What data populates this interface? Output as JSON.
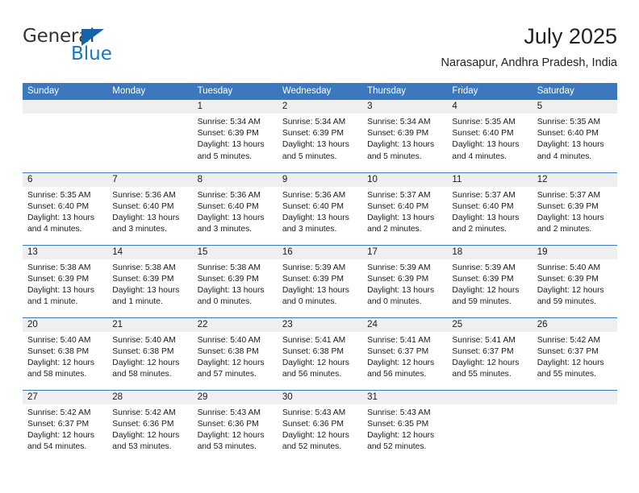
{
  "branding": {
    "logo_primary": "General",
    "logo_secondary": "Blue",
    "logo_triangle_icon": "triangle-icon",
    "primary_color": "#1464AA",
    "secondary_color": "#1778C2"
  },
  "header": {
    "title": "July 2025",
    "subtitle": "Narasapur, Andhra Pradesh, India"
  },
  "theme": {
    "header_bg": "#3C78BE",
    "daynum_bg": "#EFEFEF",
    "text_color": "#1a1a1a"
  },
  "columns": [
    "Sunday",
    "Monday",
    "Tuesday",
    "Wednesday",
    "Thursday",
    "Friday",
    "Saturday"
  ],
  "weeks": [
    [
      {
        "day": "",
        "blank": true
      },
      {
        "day": "",
        "blank": true
      },
      {
        "day": "1",
        "sunrise": "Sunrise: 5:34 AM",
        "sunset": "Sunset: 6:39 PM",
        "daylight1": "Daylight: 13 hours",
        "daylight2": "and 5 minutes."
      },
      {
        "day": "2",
        "sunrise": "Sunrise: 5:34 AM",
        "sunset": "Sunset: 6:39 PM",
        "daylight1": "Daylight: 13 hours",
        "daylight2": "and 5 minutes."
      },
      {
        "day": "3",
        "sunrise": "Sunrise: 5:34 AM",
        "sunset": "Sunset: 6:39 PM",
        "daylight1": "Daylight: 13 hours",
        "daylight2": "and 5 minutes."
      },
      {
        "day": "4",
        "sunrise": "Sunrise: 5:35 AM",
        "sunset": "Sunset: 6:40 PM",
        "daylight1": "Daylight: 13 hours",
        "daylight2": "and 4 minutes."
      },
      {
        "day": "5",
        "sunrise": "Sunrise: 5:35 AM",
        "sunset": "Sunset: 6:40 PM",
        "daylight1": "Daylight: 13 hours",
        "daylight2": "and 4 minutes."
      }
    ],
    [
      {
        "day": "6",
        "sunrise": "Sunrise: 5:35 AM",
        "sunset": "Sunset: 6:40 PM",
        "daylight1": "Daylight: 13 hours",
        "daylight2": "and 4 minutes."
      },
      {
        "day": "7",
        "sunrise": "Sunrise: 5:36 AM",
        "sunset": "Sunset: 6:40 PM",
        "daylight1": "Daylight: 13 hours",
        "daylight2": "and 3 minutes."
      },
      {
        "day": "8",
        "sunrise": "Sunrise: 5:36 AM",
        "sunset": "Sunset: 6:40 PM",
        "daylight1": "Daylight: 13 hours",
        "daylight2": "and 3 minutes."
      },
      {
        "day": "9",
        "sunrise": "Sunrise: 5:36 AM",
        "sunset": "Sunset: 6:40 PM",
        "daylight1": "Daylight: 13 hours",
        "daylight2": "and 3 minutes."
      },
      {
        "day": "10",
        "sunrise": "Sunrise: 5:37 AM",
        "sunset": "Sunset: 6:40 PM",
        "daylight1": "Daylight: 13 hours",
        "daylight2": "and 2 minutes."
      },
      {
        "day": "11",
        "sunrise": "Sunrise: 5:37 AM",
        "sunset": "Sunset: 6:40 PM",
        "daylight1": "Daylight: 13 hours",
        "daylight2": "and 2 minutes."
      },
      {
        "day": "12",
        "sunrise": "Sunrise: 5:37 AM",
        "sunset": "Sunset: 6:39 PM",
        "daylight1": "Daylight: 13 hours",
        "daylight2": "and 2 minutes."
      }
    ],
    [
      {
        "day": "13",
        "sunrise": "Sunrise: 5:38 AM",
        "sunset": "Sunset: 6:39 PM",
        "daylight1": "Daylight: 13 hours",
        "daylight2": "and 1 minute."
      },
      {
        "day": "14",
        "sunrise": "Sunrise: 5:38 AM",
        "sunset": "Sunset: 6:39 PM",
        "daylight1": "Daylight: 13 hours",
        "daylight2": "and 1 minute."
      },
      {
        "day": "15",
        "sunrise": "Sunrise: 5:38 AM",
        "sunset": "Sunset: 6:39 PM",
        "daylight1": "Daylight: 13 hours",
        "daylight2": "and 0 minutes."
      },
      {
        "day": "16",
        "sunrise": "Sunrise: 5:39 AM",
        "sunset": "Sunset: 6:39 PM",
        "daylight1": "Daylight: 13 hours",
        "daylight2": "and 0 minutes."
      },
      {
        "day": "17",
        "sunrise": "Sunrise: 5:39 AM",
        "sunset": "Sunset: 6:39 PM",
        "daylight1": "Daylight: 13 hours",
        "daylight2": "and 0 minutes."
      },
      {
        "day": "18",
        "sunrise": "Sunrise: 5:39 AM",
        "sunset": "Sunset: 6:39 PM",
        "daylight1": "Daylight: 12 hours",
        "daylight2": "and 59 minutes."
      },
      {
        "day": "19",
        "sunrise": "Sunrise: 5:40 AM",
        "sunset": "Sunset: 6:39 PM",
        "daylight1": "Daylight: 12 hours",
        "daylight2": "and 59 minutes."
      }
    ],
    [
      {
        "day": "20",
        "sunrise": "Sunrise: 5:40 AM",
        "sunset": "Sunset: 6:38 PM",
        "daylight1": "Daylight: 12 hours",
        "daylight2": "and 58 minutes."
      },
      {
        "day": "21",
        "sunrise": "Sunrise: 5:40 AM",
        "sunset": "Sunset: 6:38 PM",
        "daylight1": "Daylight: 12 hours",
        "daylight2": "and 58 minutes."
      },
      {
        "day": "22",
        "sunrise": "Sunrise: 5:40 AM",
        "sunset": "Sunset: 6:38 PM",
        "daylight1": "Daylight: 12 hours",
        "daylight2": "and 57 minutes."
      },
      {
        "day": "23",
        "sunrise": "Sunrise: 5:41 AM",
        "sunset": "Sunset: 6:38 PM",
        "daylight1": "Daylight: 12 hours",
        "daylight2": "and 56 minutes."
      },
      {
        "day": "24",
        "sunrise": "Sunrise: 5:41 AM",
        "sunset": "Sunset: 6:37 PM",
        "daylight1": "Daylight: 12 hours",
        "daylight2": "and 56 minutes."
      },
      {
        "day": "25",
        "sunrise": "Sunrise: 5:41 AM",
        "sunset": "Sunset: 6:37 PM",
        "daylight1": "Daylight: 12 hours",
        "daylight2": "and 55 minutes."
      },
      {
        "day": "26",
        "sunrise": "Sunrise: 5:42 AM",
        "sunset": "Sunset: 6:37 PM",
        "daylight1": "Daylight: 12 hours",
        "daylight2": "and 55 minutes."
      }
    ],
    [
      {
        "day": "27",
        "sunrise": "Sunrise: 5:42 AM",
        "sunset": "Sunset: 6:37 PM",
        "daylight1": "Daylight: 12 hours",
        "daylight2": "and 54 minutes."
      },
      {
        "day": "28",
        "sunrise": "Sunrise: 5:42 AM",
        "sunset": "Sunset: 6:36 PM",
        "daylight1": "Daylight: 12 hours",
        "daylight2": "and 53 minutes."
      },
      {
        "day": "29",
        "sunrise": "Sunrise: 5:43 AM",
        "sunset": "Sunset: 6:36 PM",
        "daylight1": "Daylight: 12 hours",
        "daylight2": "and 53 minutes."
      },
      {
        "day": "30",
        "sunrise": "Sunrise: 5:43 AM",
        "sunset": "Sunset: 6:36 PM",
        "daylight1": "Daylight: 12 hours",
        "daylight2": "and 52 minutes."
      },
      {
        "day": "31",
        "sunrise": "Sunrise: 5:43 AM",
        "sunset": "Sunset: 6:35 PM",
        "daylight1": "Daylight: 12 hours",
        "daylight2": "and 52 minutes."
      },
      {
        "day": "",
        "blank": true
      },
      {
        "day": "",
        "blank": true
      }
    ]
  ]
}
